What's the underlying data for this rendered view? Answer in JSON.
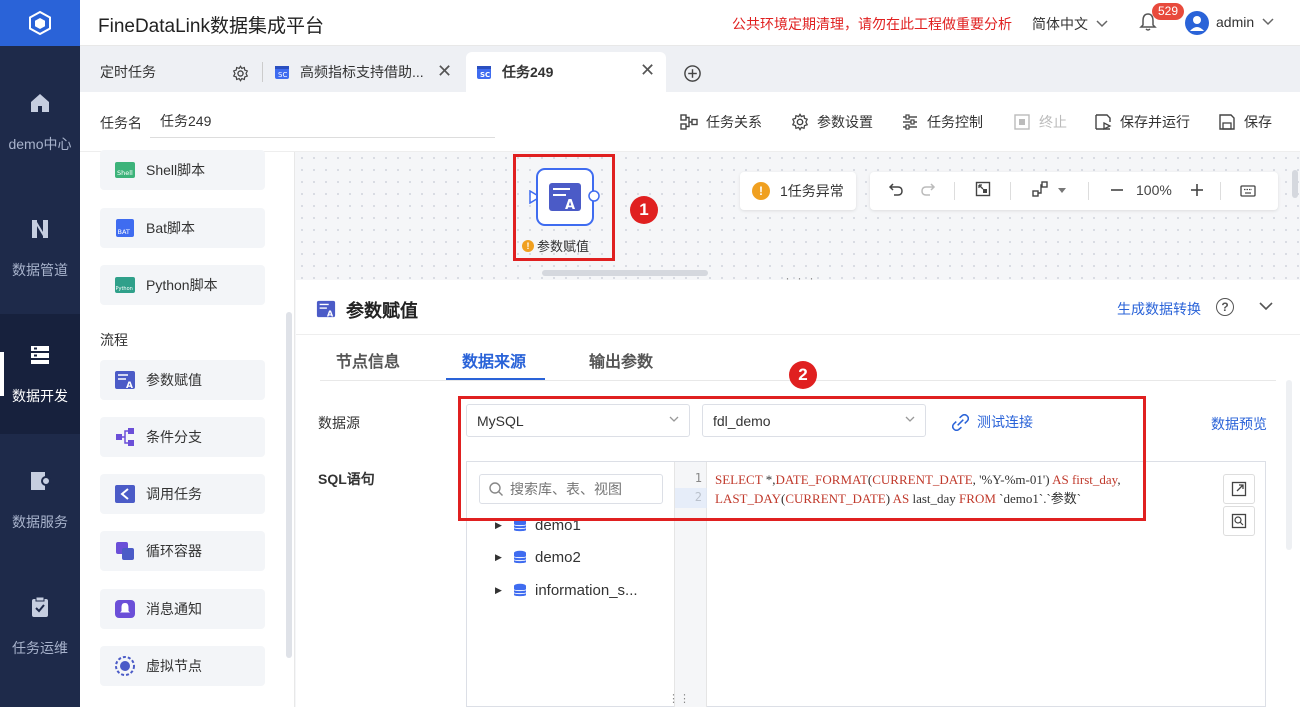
{
  "app": {
    "title": "FineDataLink数据集成平台",
    "notice": "公共环境定期清理，请勿在此工程做重要分析",
    "language": "简体中文",
    "notification_count": "529",
    "username": "admin"
  },
  "nav": {
    "items": [
      {
        "label": "demo中心",
        "icon": "home-icon"
      },
      {
        "label": "数据管道",
        "icon": "pipeline-icon"
      },
      {
        "label": "数据开发",
        "icon": "dev-icon"
      },
      {
        "label": "数据服务",
        "icon": "service-icon"
      },
      {
        "label": "任务运维",
        "icon": "ops-icon"
      }
    ],
    "active": "数据开发"
  },
  "tabs": [
    {
      "label": "定时任务"
    },
    {
      "label": "高频指标支持借助..."
    },
    {
      "label": "任务249"
    }
  ],
  "taskbar": {
    "name_label": "任务名",
    "name_value": "任务249",
    "buttons": {
      "relation": "任务关系",
      "params": "参数设置",
      "control": "任务控制",
      "stop": "终止",
      "save_run": "保存并运行",
      "save": "保存"
    }
  },
  "components": {
    "scripts": [
      "Shell脚本",
      "Bat脚本",
      "Python脚本"
    ],
    "group_label": "流程",
    "flow": [
      "参数赋值",
      "条件分支",
      "调用任务",
      "循环容器",
      "消息通知",
      "虚拟节点"
    ]
  },
  "canvas": {
    "node_label": "参数赋值",
    "marker1": "1",
    "marker2": "2",
    "exception_text": "1任务异常",
    "zoom": "100%"
  },
  "config": {
    "title": "参数赋值",
    "gen_link": "生成数据转换",
    "tabs": [
      "节点信息",
      "数据来源",
      "输出参数"
    ],
    "active_tab": "数据来源",
    "datasource_label": "数据源",
    "datasource_type": "MySQL",
    "datasource_conn": "fdl_demo",
    "test_link": "测试连接",
    "preview_link": "数据预览",
    "sql_label": "SQL语句",
    "search_placeholder": "搜索库、表、视图",
    "tree": [
      "demo1",
      "demo2",
      "information_s..."
    ],
    "line_numbers": [
      "1",
      "2"
    ]
  },
  "colors": {
    "primary": "#2a63d8",
    "nav_bg": "#1e2a4a",
    "alert_red": "#e02020",
    "warn_orange": "#f0a020"
  }
}
